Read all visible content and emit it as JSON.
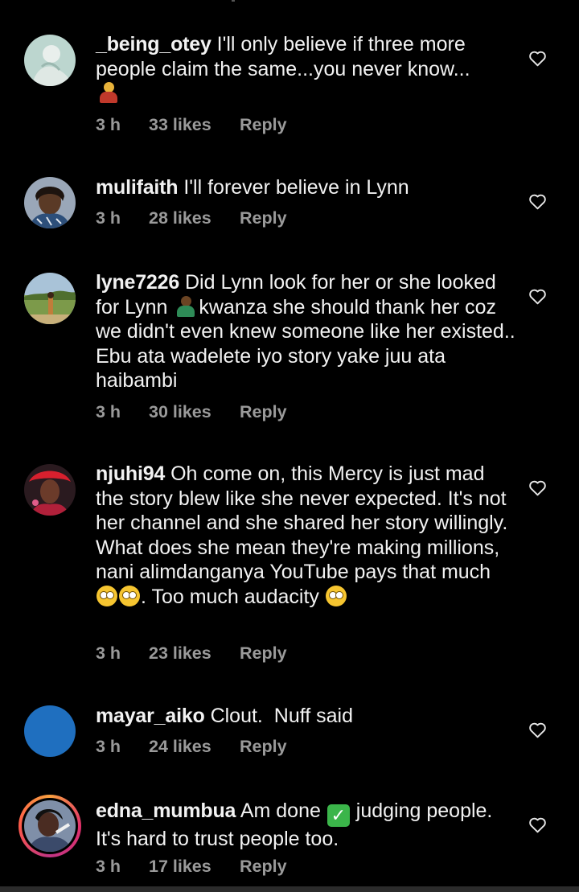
{
  "comments": [
    {
      "username": "_being_otey",
      "text": "I'll only believe if three more people claim the same...you never know...",
      "emoji": "person-shrugging",
      "time": "3 h",
      "likes": "33 likes",
      "reply": "Reply"
    },
    {
      "username": "mulifaith",
      "text": "I'll forever believe in Lynn",
      "time": "3 h",
      "likes": "28 likes",
      "reply": "Reply"
    },
    {
      "username": "lyne7226",
      "text_a": "Did Lynn look for her or she looked for Lynn",
      "emoji": "person-facepalming",
      "text_b": "kwanza she should thank her coz we didn't even knew someone like her existed.. Ebu ata wadelete iyo story yake juu ata haibambi",
      "time": "3 h",
      "likes": "30 likes",
      "reply": "Reply"
    },
    {
      "username": "njuhi94",
      "text_a": "Oh come on, this Mercy is just mad the story blew like she never expected. It's not her channel and she shared her story willingly. What does she mean they're making millions, nani alimdanganya YouTube pays that much",
      "emoji": "face-with-rolling-eyes",
      "text_b": ". Too much audacity",
      "time": "3 h",
      "likes": "23 likes",
      "reply": "Reply"
    },
    {
      "username": "mayar_aiko",
      "text": "Clout.  Nuff said",
      "time": "3 h",
      "likes": "24 likes",
      "reply": "Reply"
    },
    {
      "username": "edna_mumbua",
      "text_a": "Am done",
      "check": "✓",
      "text_b": "judging people. It's hard to trust people too.",
      "time": "3 h",
      "likes": "17 likes",
      "reply": "Reply"
    }
  ],
  "colors": {
    "background": "#000000",
    "text": "#f2f2f2",
    "meta": "#9a9a9a",
    "story_ring": "#e1306c",
    "mayar_avatar": "#1f6fbf"
  }
}
